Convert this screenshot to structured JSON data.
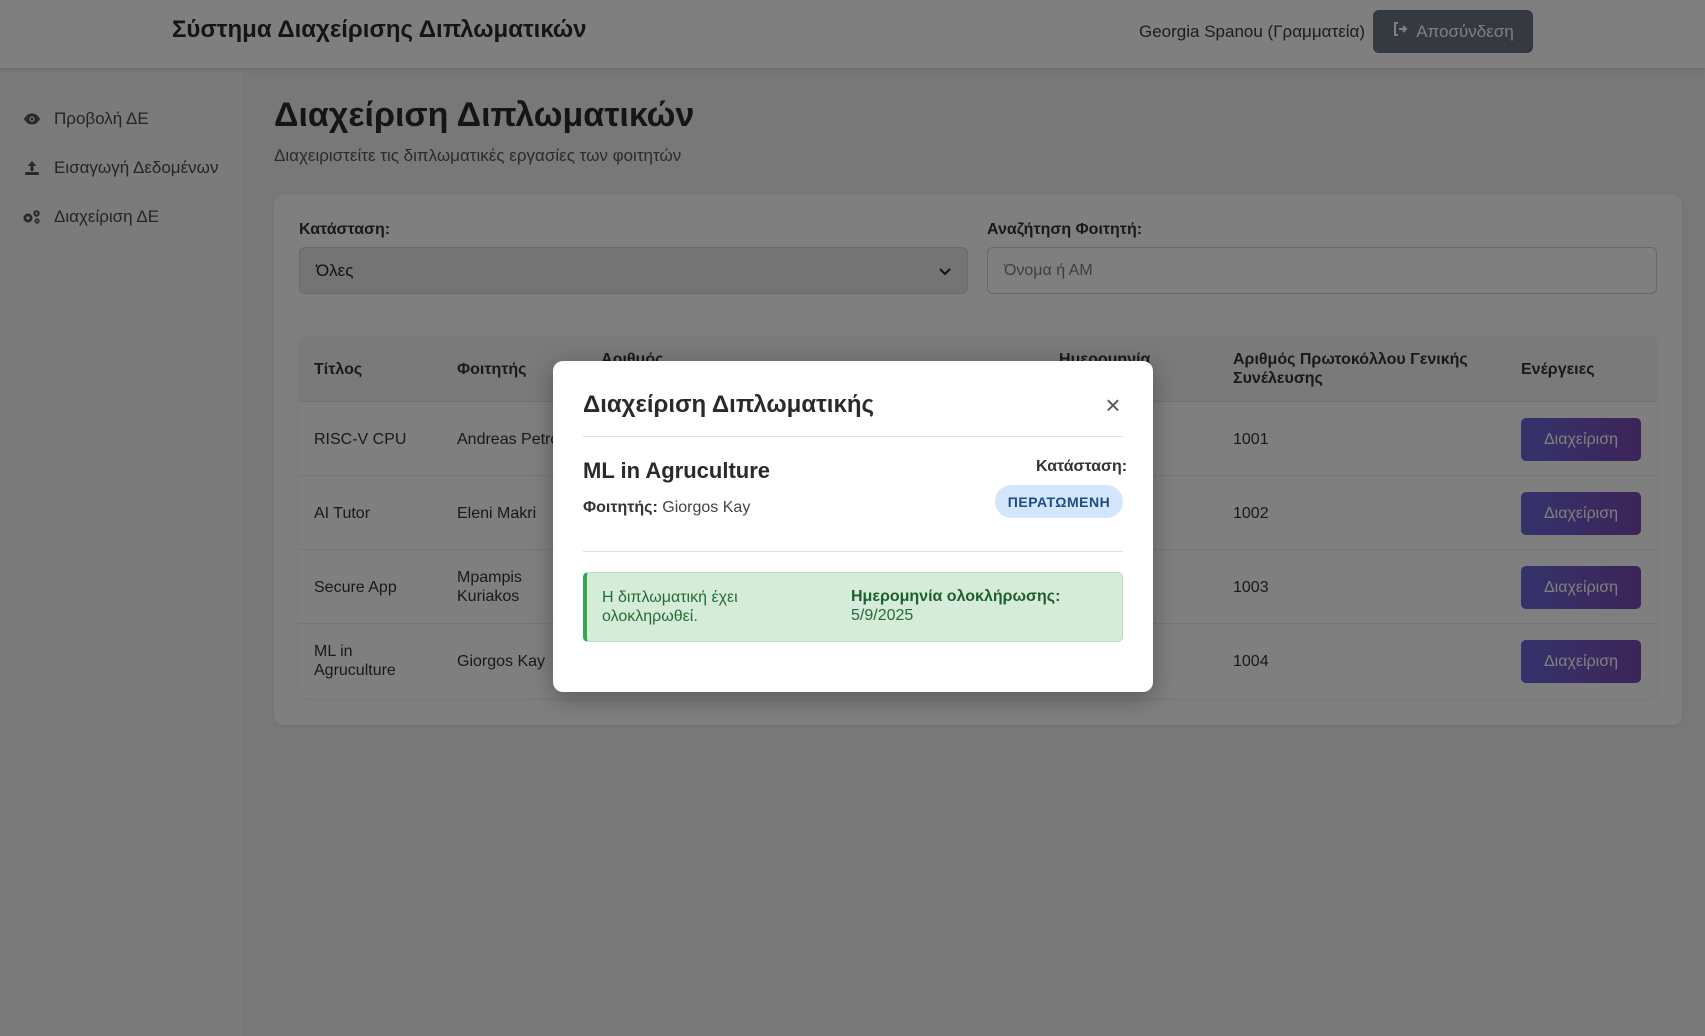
{
  "header": {
    "app_title": "Σύστημα Διαχείρισης Διπλωματικών",
    "user": "Georgia Spanou (Γραμματεία)",
    "logout_label": "Αποσύνδεση"
  },
  "sidebar": {
    "items": [
      {
        "label": "Προβολή ΔΕ",
        "icon": "eye-icon"
      },
      {
        "label": "Εισαγωγή Δεδομένων",
        "icon": "upload-icon"
      },
      {
        "label": "Διαχείριση ΔΕ",
        "icon": "gears-icon"
      }
    ]
  },
  "main": {
    "title": "Διαχείριση Διπλωματικών",
    "subtitle": "Διαχειριστείτε τις διπλωματικές εργασίες των φοιτητών",
    "filters": {
      "status_label": "Κατάσταση:",
      "status_value": "Όλες",
      "search_label": "Αναζήτηση Φοιτητή:",
      "search_placeholder": "Όνομα ή ΑΜ"
    },
    "table": {
      "headers": {
        "title": "Τίτλος",
        "student": "Φοιτητής",
        "number": "Αριθμός",
        "date": "Ημερομηνία",
        "protocol_line1": "Αριθμός Πρωτοκόλλου Γενικής",
        "protocol_line2": "Συνέλευσης",
        "actions": "Ενέργειες"
      },
      "rows": [
        {
          "title_line1": "RISC-V CPU",
          "title_line2": "",
          "student_line1": "Andreas Petro",
          "student_line2": "",
          "protocol": "1001",
          "action": "Διαχείριση"
        },
        {
          "title_line1": "AI Tutor",
          "title_line2": "",
          "student_line1": "Eleni Makri",
          "student_line2": "",
          "protocol": "1002",
          "action": "Διαχείριση"
        },
        {
          "title_line1": "Secure App",
          "title_line2": "",
          "student_line1": "Mpampis",
          "student_line2": "Kuriakos",
          "protocol": "1003",
          "action": "Διαχείριση"
        },
        {
          "title_line1": "ML in",
          "title_line2": "Agruculture",
          "student_line1": "Giorgos Kay",
          "student_line2": "",
          "protocol": "1004",
          "action": "Διαχείριση"
        }
      ]
    }
  },
  "modal": {
    "title": "Διαχείριση Διπλωματικής",
    "close_symbol": "×",
    "thesis_title": "ML in Agruculture",
    "student_label": "Φοιτητής:",
    "student_name": "Giorgos Kay",
    "status_label": "Κατάσταση:",
    "status_value": "ΠΕΡΑΤΩΜΕΝΗ",
    "success_message": "Η διπλωματική έχει ολοκληρωθεί.",
    "completion_label": "Ημερομηνία ολοκλήρωσης:",
    "completion_date": "5/9/2025"
  },
  "colors": {
    "accent_button": "#6a66d8",
    "status_badge_bg": "#d3e6fb",
    "success_bg": "#d5ecda",
    "success_border": "#2fa84f"
  }
}
